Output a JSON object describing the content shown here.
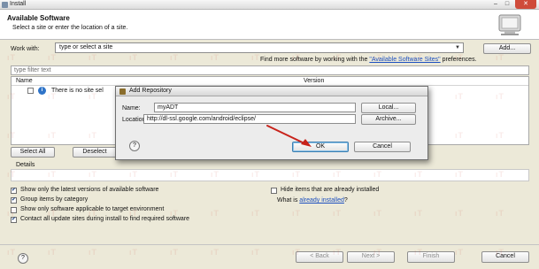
{
  "window": {
    "title": "Install",
    "close_glyph": "✕",
    "minimize_glyph": "–",
    "maximize_glyph": "□"
  },
  "banner": {
    "title": "Available Software",
    "subtitle": "Select a site or enter the location of a site."
  },
  "work_with": {
    "label": "Work with:",
    "value": "type or select a site",
    "add_button": "Add..."
  },
  "find_more": {
    "prefix": "Find more software by working with the ",
    "link": "\"Available Software Sites\"",
    "suffix": " preferences."
  },
  "filter": {
    "placeholder": "type filter text"
  },
  "table": {
    "columns": [
      "Name",
      "Version"
    ],
    "row_text": "There is no site sel"
  },
  "buttons": {
    "select_all": "Select All",
    "deselect": "Deselect"
  },
  "details": {
    "label": "Details"
  },
  "options": [
    {
      "label": "Show only the latest versions of available software",
      "checked": true
    },
    {
      "label": "Group items by category",
      "checked": true
    },
    {
      "label": "Show only software applicable to target environment",
      "checked": false
    },
    {
      "label": "Contact all update sites during install to find required software",
      "checked": true
    },
    {
      "label": "Hide items that are already installed",
      "checked": false
    }
  ],
  "what_installed": {
    "prefix": "What is ",
    "link": "already installed",
    "suffix": "?"
  },
  "footer": {
    "help": "?",
    "back": "< Back",
    "next": "Next >",
    "finish": "Finish",
    "cancel": "Cancel"
  },
  "dialog": {
    "title": "Add Repository",
    "name_label": "Name:",
    "name_value": "myADT",
    "location_label": "Location:",
    "location_value": "http://dl-ssl.google.com/android/eclipse/",
    "local_button": "Local...",
    "archive_button": "Archive...",
    "help": "?",
    "ok_button": "OK",
    "cancel_button": "Cancel"
  },
  "icons": {
    "check": "✔",
    "info": "i",
    "dropdown": "▼"
  },
  "colors": {
    "link": "#1c4fbf",
    "annotation_arrow": "#c8231b",
    "close_button": "#cf4b3a"
  }
}
